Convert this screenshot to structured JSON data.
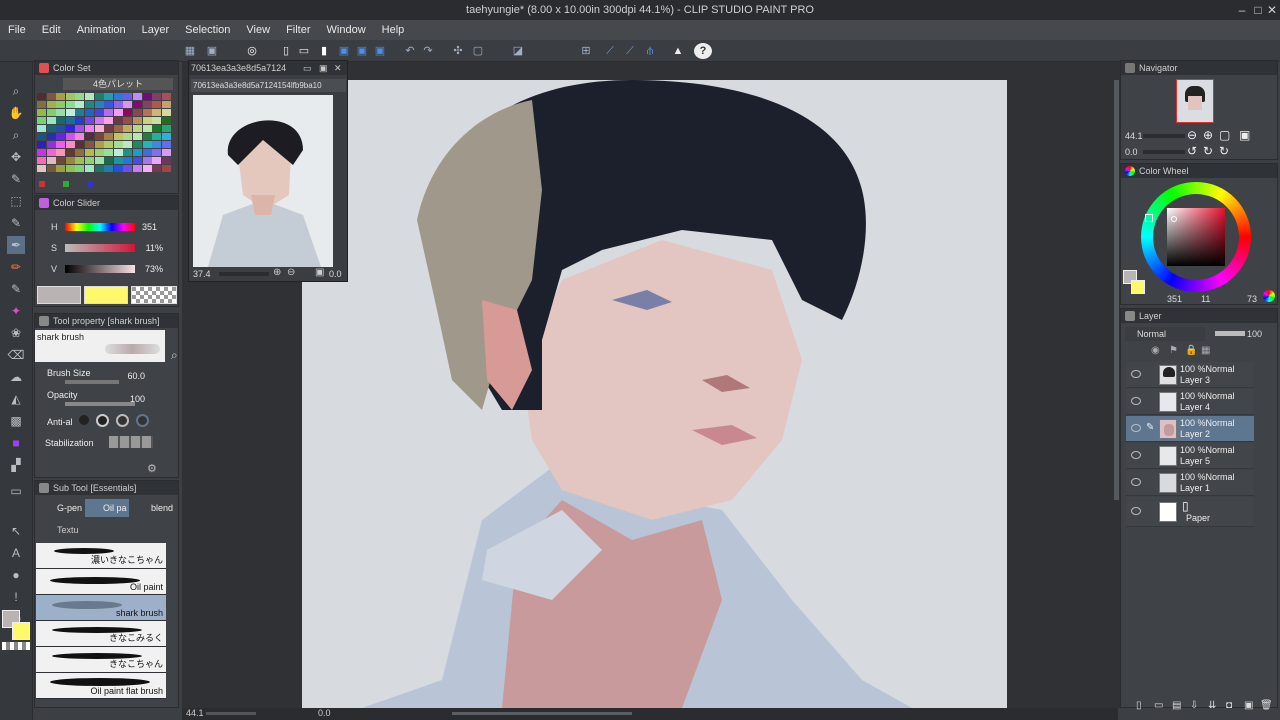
{
  "window": {
    "title": "taehyungie* (8.00 x 10.00in 300dpi 44.1%) - CLIP STUDIO PAINT PRO"
  },
  "menu": [
    "File",
    "Edit",
    "Animation",
    "Layer",
    "Selection",
    "View",
    "Filter",
    "Window",
    "Help"
  ],
  "color_set": {
    "title": "Color Set",
    "palette_name": "4色パレット"
  },
  "color_slider": {
    "title": "Color Slider",
    "h_label": "H",
    "h": "351",
    "s_label": "S",
    "s": "11%",
    "v_label": "V",
    "v": "73%"
  },
  "tool_property": {
    "title": "Tool property [shark brush]",
    "brush_name": "shark brush",
    "brush_size_label": "Brush Size",
    "brush_size": "60.0",
    "opacity_label": "Opacity",
    "opacity": "100",
    "anti_label": "Anti-al",
    "stabilization_label": "Stabilization"
  },
  "sub_tool": {
    "title": "Sub Tool [Essentials]",
    "tabs": [
      "G-pen",
      "Oil pa",
      "blend",
      "Textu"
    ],
    "brushes": [
      "濃いきなこちゃん",
      "Oil paint",
      "shark brush",
      "きなこみるく",
      "きなこちゃん",
      "Oil paint flat brush"
    ]
  },
  "reference": {
    "title": "70613ea3a3e8d5a7124",
    "filename": "70613ea3a3e8d5a7124154lfb9ba10",
    "zoom": "37.4",
    "angle": "0.0"
  },
  "navigator": {
    "title": "Navigator",
    "zoom": "44.1",
    "angle": "0.0"
  },
  "color_wheel": {
    "title": "Color Wheel",
    "h": "351",
    "s": "11",
    "v": "73"
  },
  "layer_panel": {
    "title": "Layer",
    "blend_mode": "Normal",
    "opacity": "100",
    "layers": [
      {
        "mode": "100 %Normal",
        "name": "Layer 3"
      },
      {
        "mode": "100 %Normal",
        "name": "Layer 4"
      },
      {
        "mode": "100 %Normal",
        "name": "Layer 2"
      },
      {
        "mode": "100 %Normal",
        "name": "Layer 5"
      },
      {
        "mode": "100 %Normal",
        "name": "Layer 1"
      },
      {
        "mode": "",
        "name": "Paper"
      }
    ]
  },
  "status": {
    "zoom": "44.1",
    "angle": "0.0"
  },
  "colors": {
    "main": "#b9b3b4",
    "sub": "#fff86a",
    "accent": "#5f7691"
  }
}
